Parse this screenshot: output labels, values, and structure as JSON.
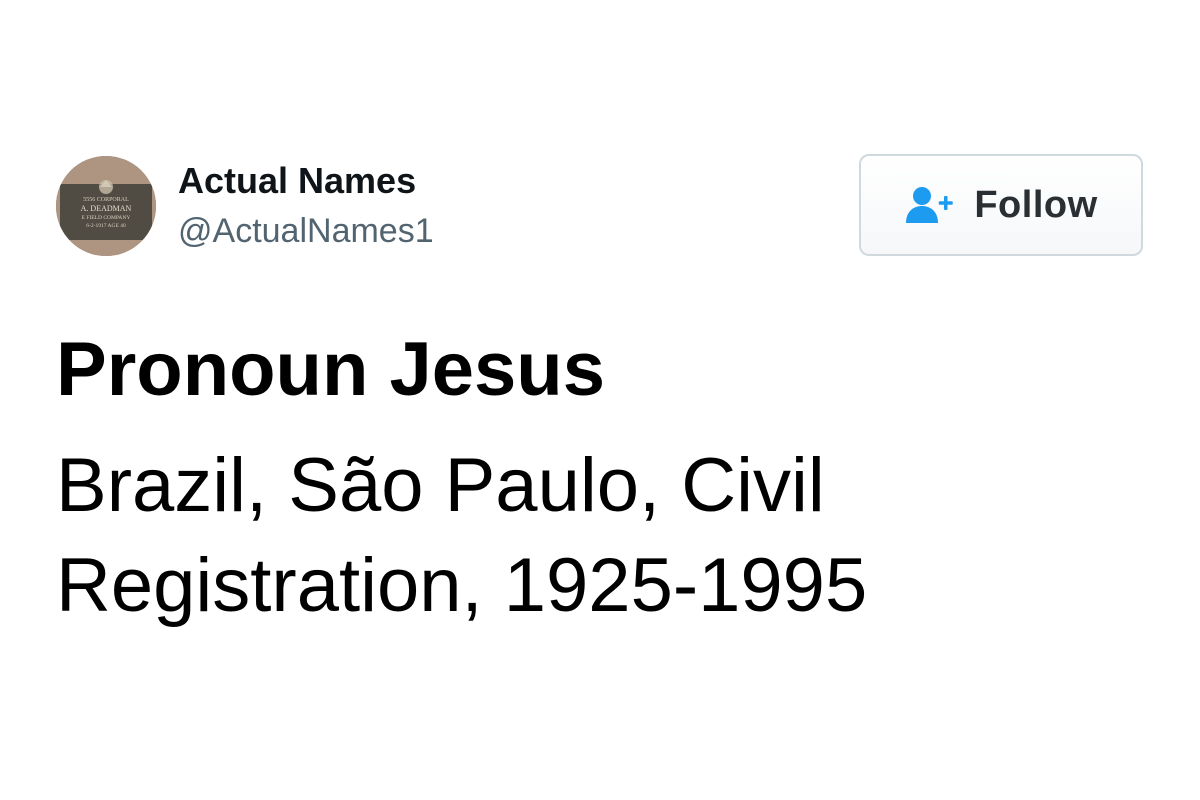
{
  "profile": {
    "display_name": "Actual Names",
    "handle": "@ActualNames1",
    "avatar": {
      "plaque_line1": "5556 CORPORAL",
      "plaque_line2": "A. DEADMAN",
      "plaque_line3": "E FIELD COMPANY",
      "plaque_line4": "6-2-1917 AGE 40"
    }
  },
  "follow_button": {
    "label": "Follow",
    "icon": "person-add-icon",
    "icon_color": "#1d9bf0"
  },
  "tweet": {
    "title": "Pronoun Jesus",
    "lines": [
      "Brazil, São Paulo, Civil",
      "Registration, 1925-1995"
    ]
  }
}
